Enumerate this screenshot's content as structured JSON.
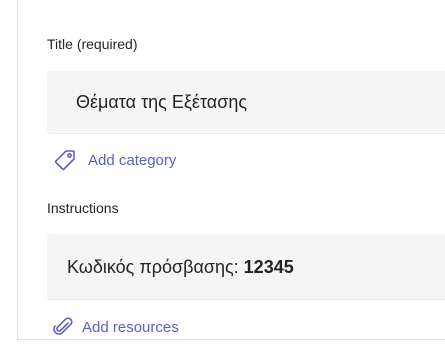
{
  "title_section": {
    "label": "Title (required)",
    "value": "Θέματα της Εξέτασης"
  },
  "category": {
    "add_label": "Add category",
    "icon": "tag-icon"
  },
  "instructions_section": {
    "label": "Instructions",
    "value_prefix": "Κωδικός πρόσβασης: ",
    "value_code": "12345"
  },
  "resources": {
    "add_label": "Add resources",
    "icon": "paperclip-icon"
  },
  "colors": {
    "accent": "#5b5fc7",
    "field_background": "#f5f5f5",
    "text": "#242424"
  }
}
